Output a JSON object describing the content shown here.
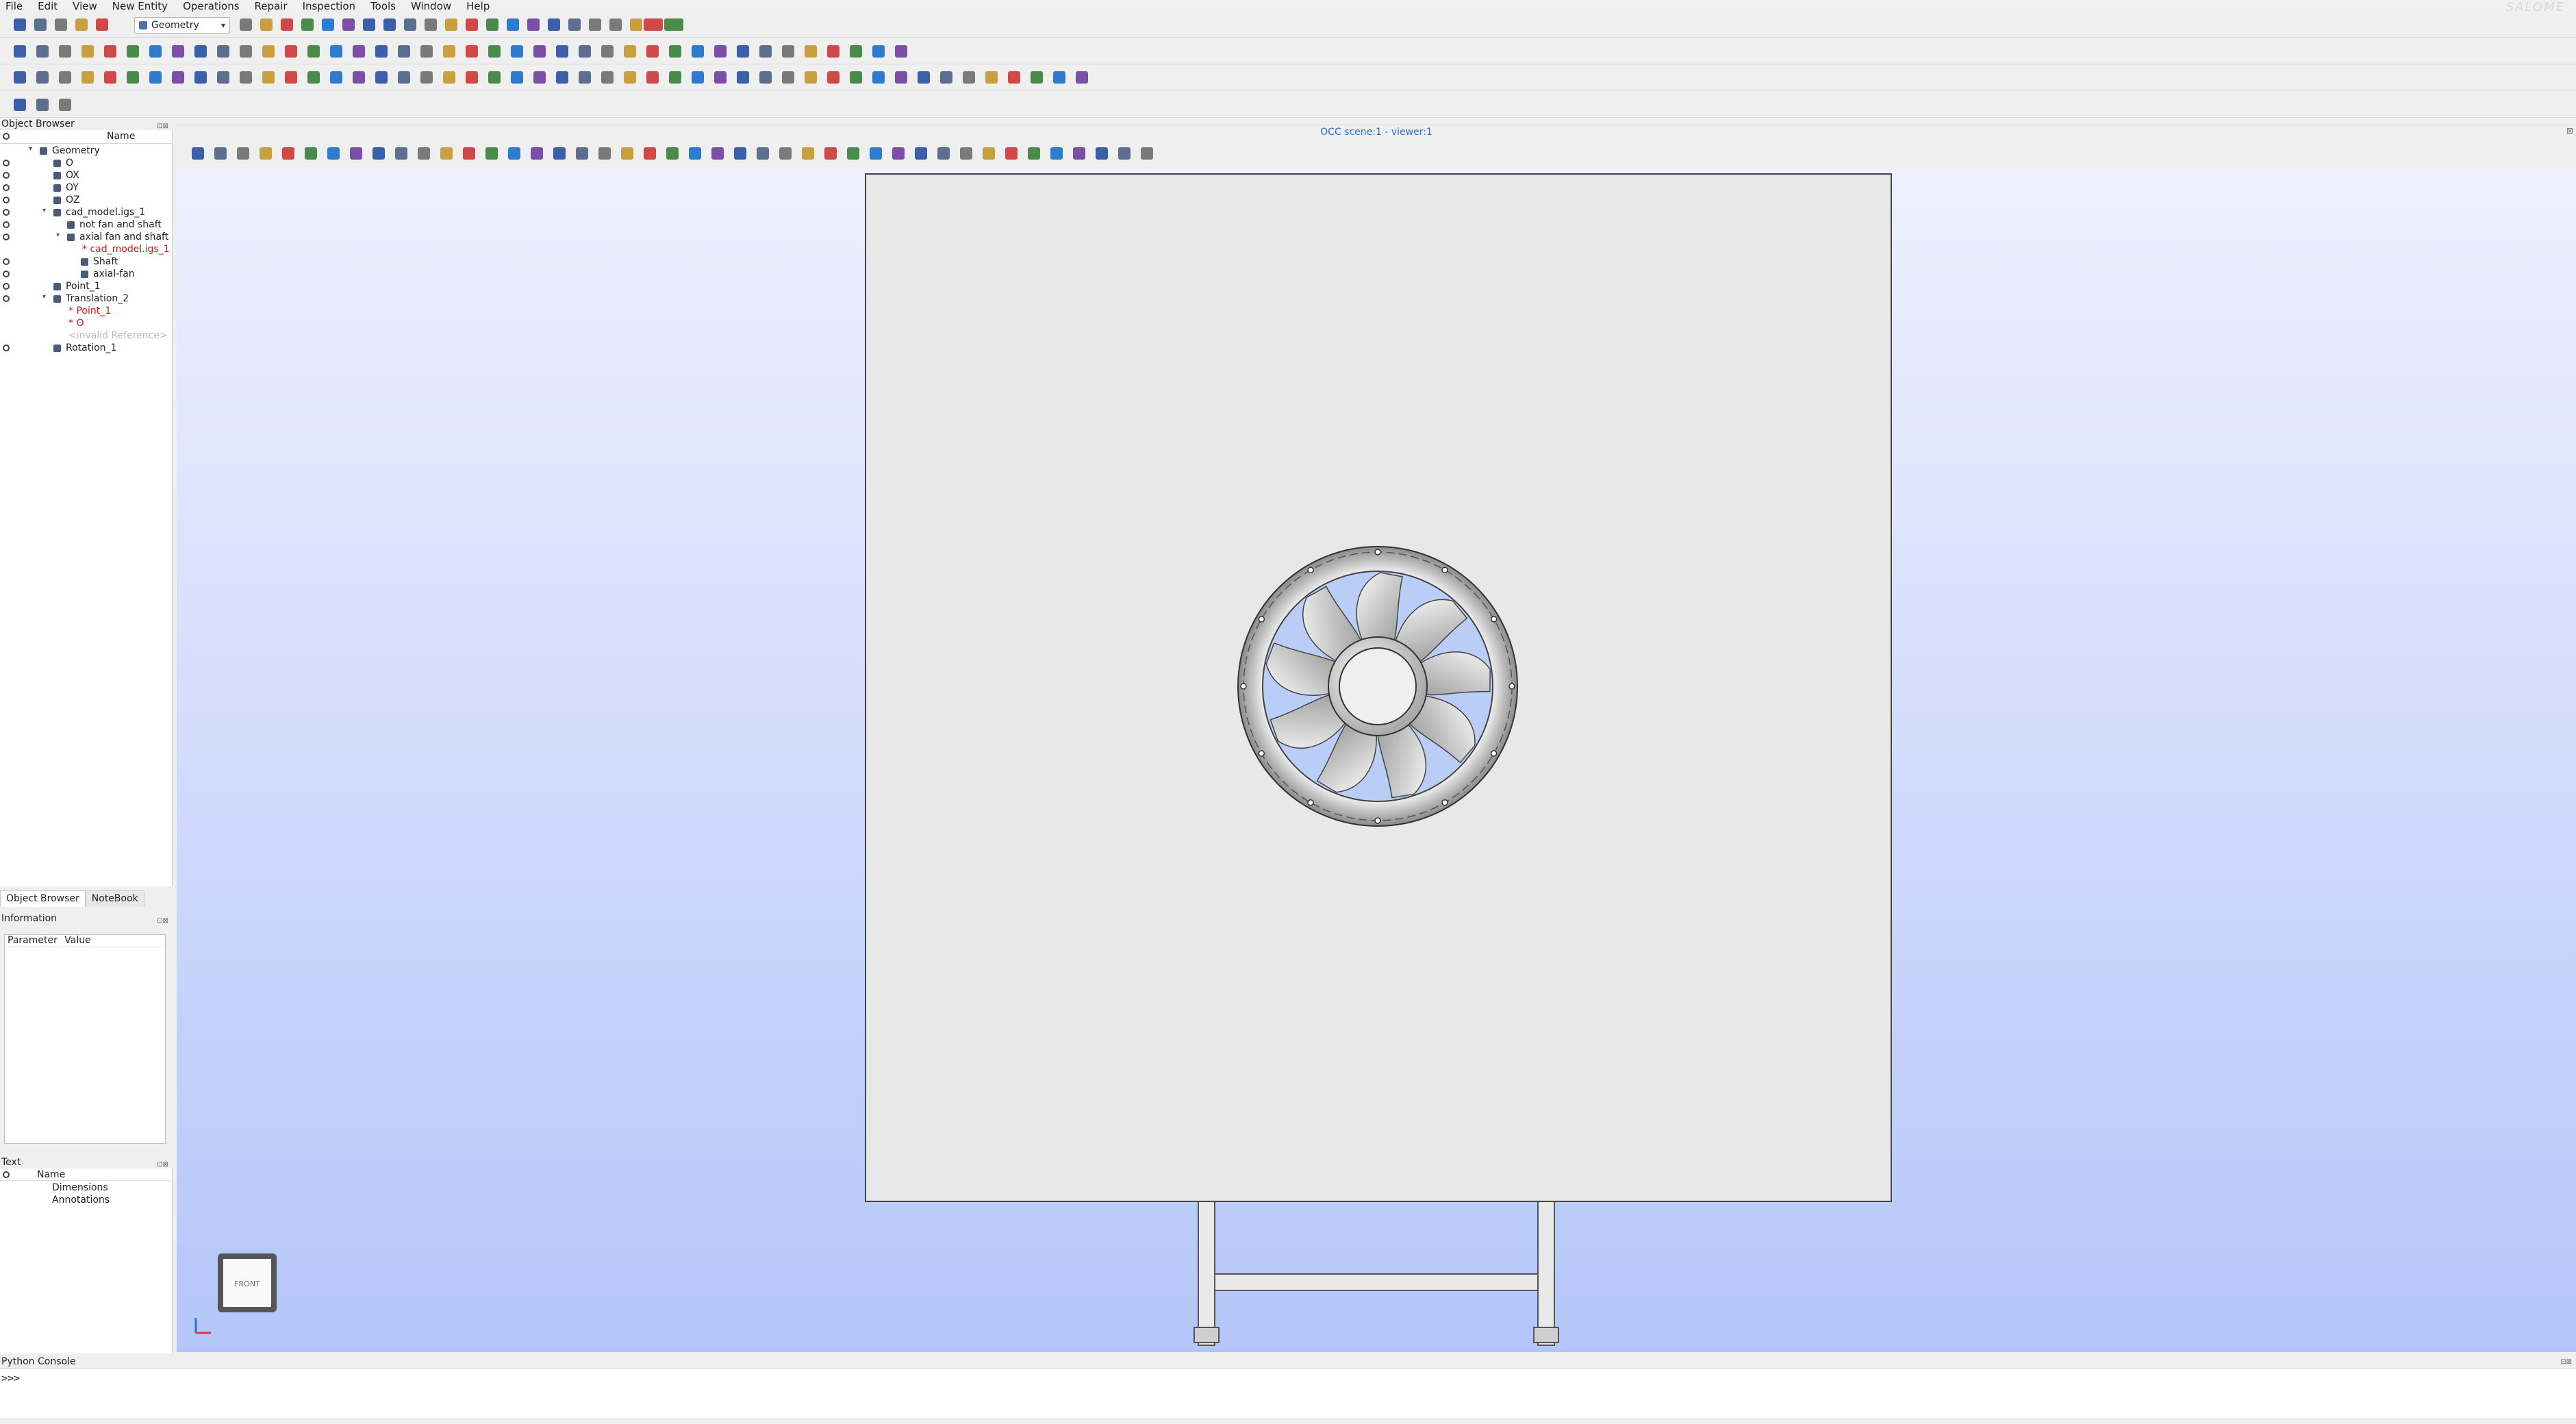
{
  "app": {
    "brand": "SALOME"
  },
  "menubar": [
    "File",
    "Edit",
    "View",
    "New Entity",
    "Operations",
    "Repair",
    "Inspection",
    "Tools",
    "Window",
    "Help"
  ],
  "module_select": {
    "value": "Geometry"
  },
  "object_browser": {
    "title": "Object Browser",
    "column_name": "Name",
    "items": [
      {
        "label": "Geometry",
        "depth": 0,
        "expanded": true,
        "visible": false
      },
      {
        "label": "O",
        "depth": 1,
        "visible": true
      },
      {
        "label": "OX",
        "depth": 1,
        "visible": true
      },
      {
        "label": "OY",
        "depth": 1,
        "visible": true
      },
      {
        "label": "OZ",
        "depth": 1,
        "visible": true
      },
      {
        "label": "cad_model.igs_1",
        "depth": 1,
        "expanded": true,
        "visible": true
      },
      {
        "label": "not fan and shaft",
        "depth": 2,
        "visible": true
      },
      {
        "label": "axial fan and shaft",
        "depth": 2,
        "expanded": true,
        "visible": true
      },
      {
        "label": "* cad_model.igs_1",
        "depth": 3,
        "color": "red"
      },
      {
        "label": "Shaft",
        "depth": 3,
        "visible": true
      },
      {
        "label": "axial-fan",
        "depth": 3,
        "visible": true
      },
      {
        "label": "Point_1",
        "depth": 1,
        "visible": true
      },
      {
        "label": "Translation_2",
        "depth": 1,
        "expanded": true,
        "visible": true
      },
      {
        "label": "* Point_1",
        "depth": 2,
        "color": "red"
      },
      {
        "label": "* O",
        "depth": 2,
        "color": "red"
      },
      {
        "label": "<invalid Reference>",
        "depth": 2,
        "color": "grey"
      },
      {
        "label": "Rotation_1",
        "depth": 1,
        "visible": true
      }
    ]
  },
  "tabs": [
    {
      "label": "Object Browser",
      "active": true
    },
    {
      "label": "NoteBook",
      "active": false
    }
  ],
  "information": {
    "title": "Information",
    "columns": [
      "Parameter",
      "Value"
    ]
  },
  "text_panel": {
    "title": "Text",
    "column_name": "Name",
    "items": [
      "Dimensions",
      "Annotations"
    ]
  },
  "viewer": {
    "title": "OCC scene:1 - viewer:1",
    "view_cube_label": "FRONT"
  },
  "python_console": {
    "title": "Python Console",
    "prompt": ">>>"
  },
  "colors": {
    "accent_blue": "#2a6fd6",
    "bg_top": "#eef0fd",
    "bg_bottom": "#b4c6f9",
    "red_ref": "#e01010"
  }
}
